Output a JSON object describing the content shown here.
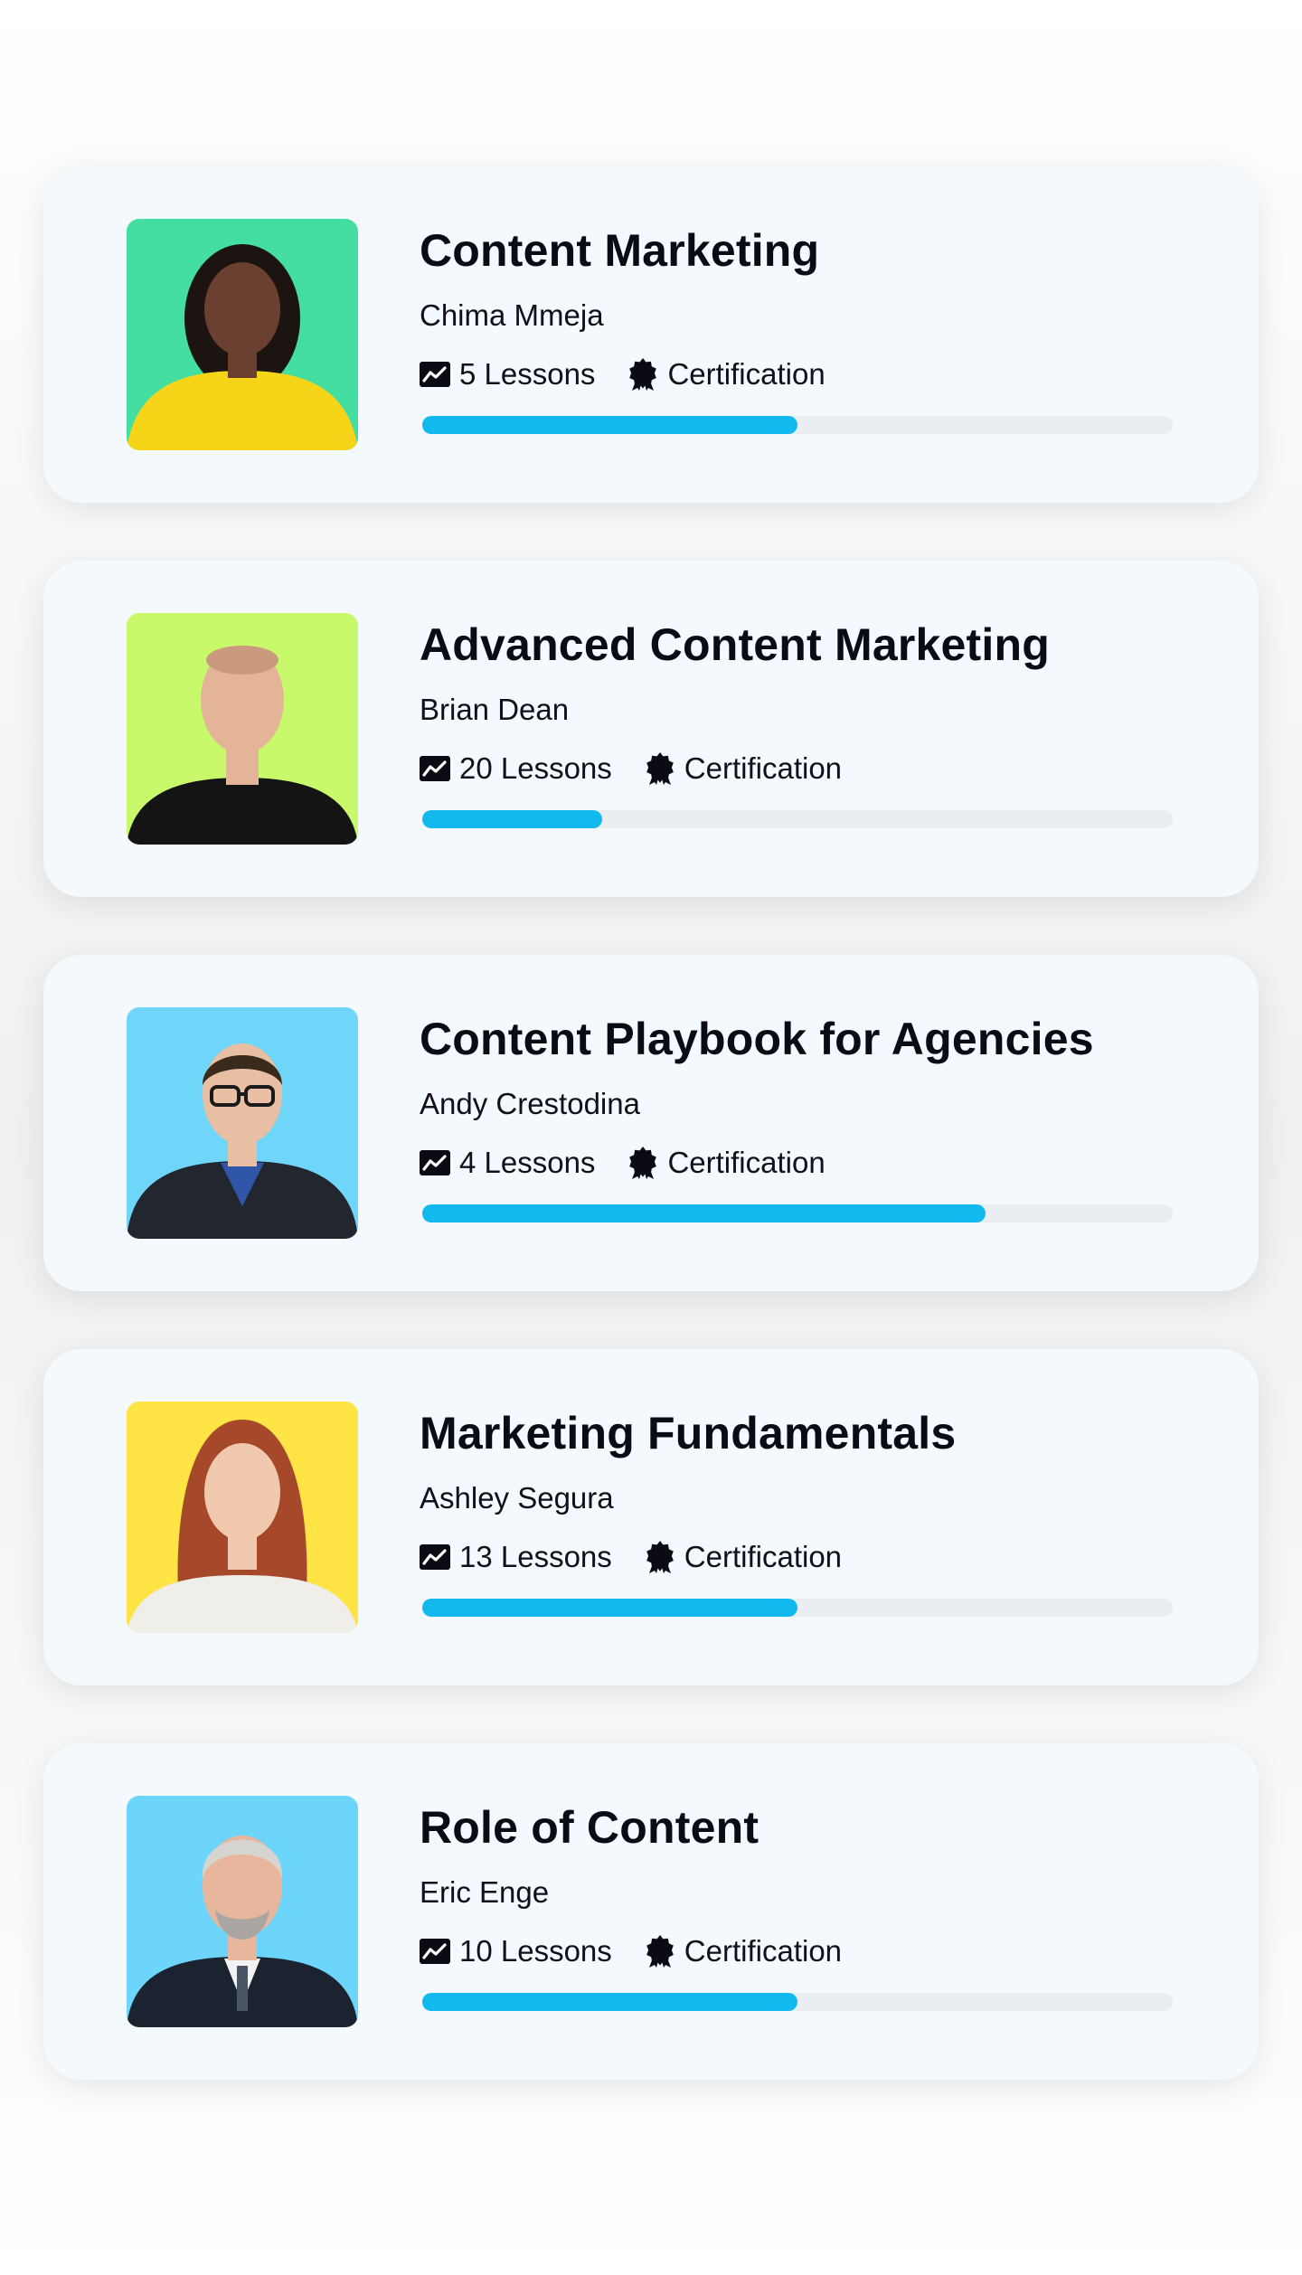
{
  "courses": [
    {
      "title": "Content Marketing",
      "author": "Chima Mmeja",
      "lessons": "5 Lessons",
      "certification": "Certification",
      "progress_percent": 50,
      "photo": {
        "background": "#45dea1",
        "shirt": "#f6d417",
        "skin": "#6b4030",
        "hair": "#1c1410"
      }
    },
    {
      "title": "Advanced Content Marketing",
      "author": "Brian Dean",
      "lessons": "20 Lessons",
      "certification": "Certification",
      "progress_percent": 24,
      "photo": {
        "background": "#c8f96a",
        "shirt": "#141414",
        "skin": "#e3b497",
        "hair": "#c99a7d"
      }
    },
    {
      "title": "Content Playbook for Agencies",
      "author": "Andy Crestodina",
      "lessons": "4 Lessons",
      "certification": "Certification",
      "progress_percent": 75,
      "photo": {
        "background": "#6fd6f9",
        "shirt": "#22262e",
        "skin": "#e9bfa3",
        "hair": "#3a2a1c"
      }
    },
    {
      "title": "Marketing Fundamentals",
      "author": "Ashley Segura",
      "lessons": "13 Lessons",
      "certification": "Certification",
      "progress_percent": 50,
      "photo": {
        "background": "#ffe445",
        "shirt": "#efeee8",
        "skin": "#f0c8ae",
        "hair": "#a6482a"
      }
    },
    {
      "title": "Role of Content",
      "author": "Eric Enge",
      "lessons": "10 Lessons",
      "certification": "Certification",
      "progress_percent": 50,
      "photo": {
        "background": "#6ed5fa",
        "shirt": "#1c2330",
        "skin": "#e7b69c",
        "hair": "#d6d4d0"
      }
    }
  ],
  "icons": {
    "lessons": "trending-chart-icon",
    "certification": "award-badge-icon"
  },
  "colors": {
    "progress_fill": "#12b9ee",
    "progress_track": "#e9eef3",
    "card_background": "#f3f9fd"
  }
}
